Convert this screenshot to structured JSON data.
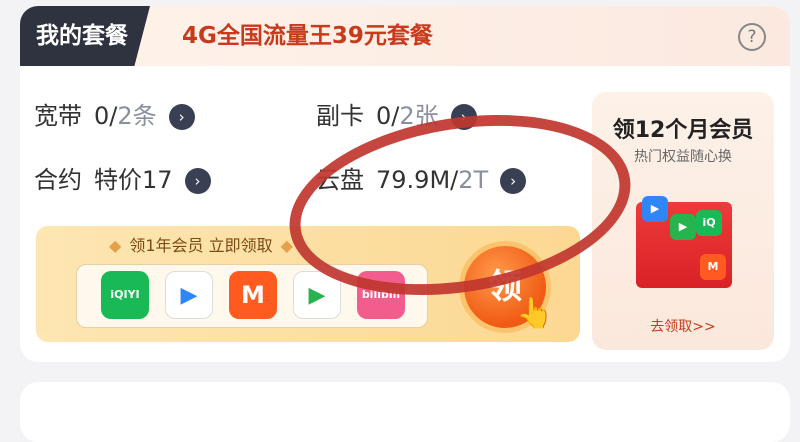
{
  "header": {
    "tab_label": "我的套餐",
    "plan_name": "4G全国流量王39元套餐",
    "help_label": "?"
  },
  "items": {
    "broadband": {
      "label": "宽带",
      "value_used": "0/",
      "value_total": "2条"
    },
    "subcard": {
      "label": "副卡",
      "value_used": "0/",
      "value_total": "2张"
    },
    "contract": {
      "label": "合约",
      "value_used": "特价17",
      "value_total": ""
    },
    "cloud": {
      "label": "云盘",
      "value_used": "79.9M/",
      "value_total": "2T"
    }
  },
  "promo": {
    "title": "领1年会员 立即领取",
    "dot": "◆",
    "button_label": "领",
    "apps": [
      {
        "label": "iQIYI",
        "color": "#19b955"
      },
      {
        "label": "▶",
        "color": "#2f86f6"
      },
      {
        "label": "M",
        "color": "#ff5a1f"
      },
      {
        "label": "▶",
        "color": "#27b34d"
      },
      {
        "label": "bilibili",
        "color": "#f25d8e"
      }
    ]
  },
  "side": {
    "title": "领12个月会员",
    "subtitle": "热门权益随心换",
    "link": "去领取>>"
  },
  "colors": {
    "accent": "#c83a1c",
    "dark_tab": "#2f3340",
    "annotation": "#c0362f"
  }
}
